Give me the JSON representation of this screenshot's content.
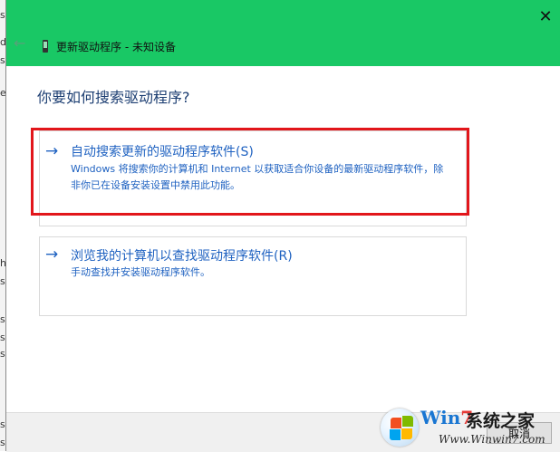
{
  "background_strip": [
    "s",
    "d",
    "s",
    "e",
    "h",
    "s",
    "s",
    "s",
    "s",
    "s",
    "s"
  ],
  "titlebar": {
    "back_glyph": "←",
    "title": "更新驱动程序 - 未知设备",
    "close_glyph": "✕"
  },
  "main": {
    "heading": "你要如何搜索驱动程序?",
    "options": [
      {
        "label": "自动搜索更新的驱动程序软件(S)",
        "description": "Windows 将搜索你的计算机和 Internet 以获取适合你设备的最新驱动程序软件，除非你已在设备安装设置中禁用此功能。",
        "icon": "arrow-right-icon",
        "highlighted": true
      },
      {
        "label": "浏览我的计算机以查找驱动程序软件(R)",
        "description": "手动查找并安装驱动程序软件。",
        "icon": "arrow-right-icon",
        "highlighted": false
      }
    ]
  },
  "footer": {
    "cancel_label": "取消"
  },
  "watermark": {
    "brand_win": "Win",
    "brand_seven": "7",
    "brand_cn": "系统之家",
    "url": "Www.Winwin7.com"
  },
  "colors": {
    "titlebar": "#19c865",
    "link_blue": "#1f62c1",
    "heading_blue": "#1c3e72",
    "highlight_red": "#e2161b"
  },
  "arrow_glyph": "→"
}
